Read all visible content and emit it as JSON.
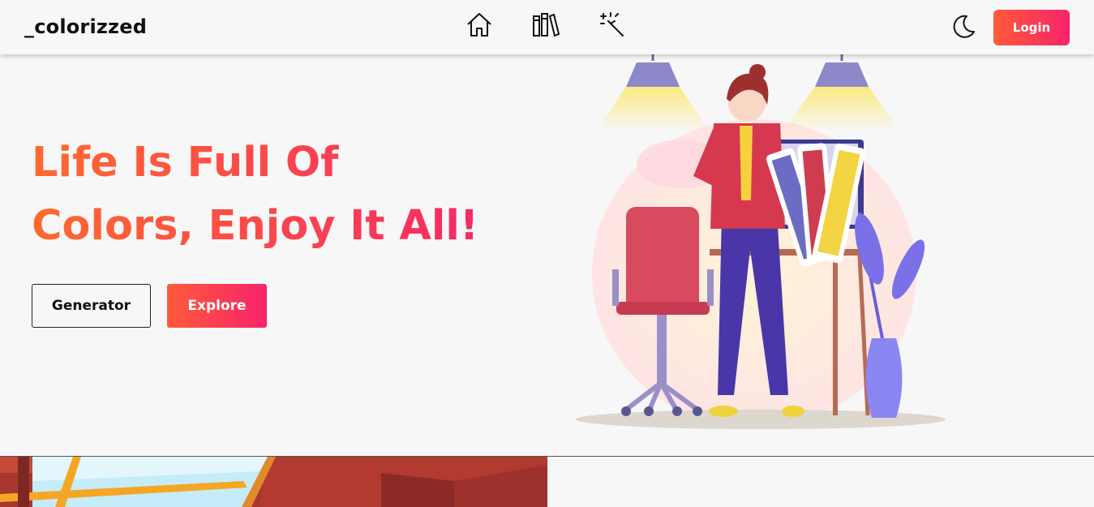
{
  "header": {
    "logo": "_colorizzed",
    "nav_icons": [
      "home-icon",
      "library-icon",
      "magic-wand-icon"
    ],
    "theme_icon": "moon-icon",
    "login_label": "Login"
  },
  "hero": {
    "title_line1": "Life Is Full Of",
    "title_line2": "Colors, Enjoy It All!",
    "generator_label": "Generator",
    "explore_label": "Explore"
  },
  "colors": {
    "accent_start": "#ff5a3a",
    "accent_end": "#f7236b",
    "background": "#f7f7f7"
  }
}
